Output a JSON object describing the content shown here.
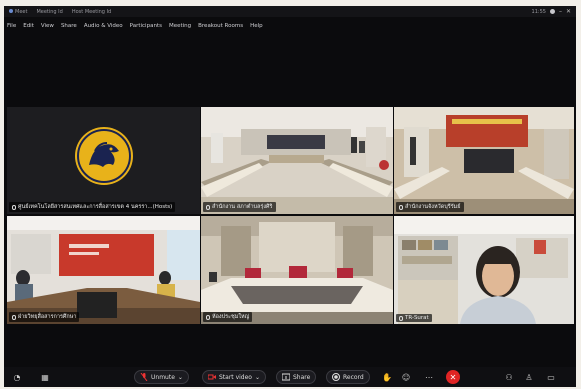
{
  "window": {
    "title_items": [
      "Meet",
      "Meeting Id",
      "Host Meeting Id"
    ],
    "time": "11:55"
  },
  "menu": [
    "File",
    "Edit",
    "View",
    "Share",
    "Audio & Video",
    "Participants",
    "Meeting",
    "Breakout Rooms",
    "Help"
  ],
  "tiles": [
    {
      "name": "ศูนย์เทคโนโลยีสารสนเทศและการสื่อสารเขต 4 นครรา...(Hosts)"
    },
    {
      "name": "สำนักงาน สภาตำบลรุ่งศิริ"
    },
    {
      "name": "สำนักงานจังหวัดบุรีรัมย์"
    },
    {
      "name": "ฝ่ายวิทยุสื่อสารการศึกษา"
    },
    {
      "name": "ห้องประชุมใหญ่"
    },
    {
      "name": "TR-Surat"
    }
  ],
  "toolbar": {
    "unmute": "Unmute",
    "start_video": "Start video",
    "share": "Share",
    "record": "Record"
  },
  "colors": {
    "background": "#0b0b0d",
    "end_button": "#e02424",
    "logo_gold": "#e8b21a",
    "logo_navy": "#1a2350"
  }
}
